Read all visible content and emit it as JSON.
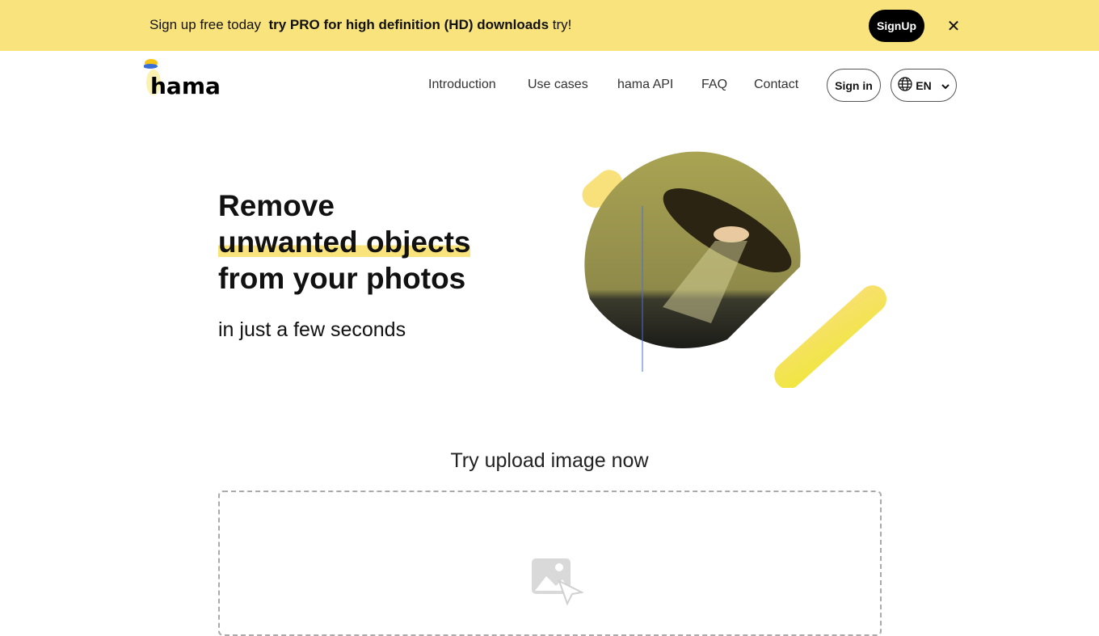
{
  "banner": {
    "text": "Sign up free today",
    "bold": "try PRO for high definition (HD) downloads",
    "suffix": "try!",
    "signup": "SignUp"
  },
  "logo": "hama",
  "nav": {
    "items": [
      "Introduction",
      "Use cases",
      "hama API",
      "FAQ",
      "Contact"
    ],
    "sign_in": "Sign in",
    "language": "EN"
  },
  "hero": {
    "line1": "Remove",
    "line2": "unwanted objects",
    "line3": "from your photos",
    "subtitle": "in just a few seconds"
  },
  "upload": {
    "title": "Try upload image now"
  },
  "colors": {
    "accent": "#f9e37c",
    "dark": "#000000"
  }
}
